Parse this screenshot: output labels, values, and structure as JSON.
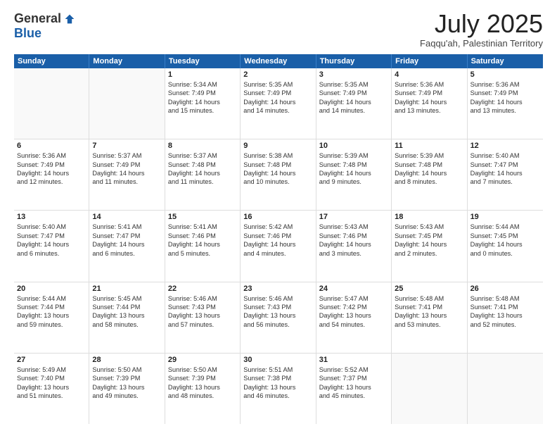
{
  "header": {
    "logo_general": "General",
    "logo_blue": "Blue",
    "title": "July 2025",
    "subtitle": "Faqqu'ah, Palestinian Territory"
  },
  "weekdays": [
    "Sunday",
    "Monday",
    "Tuesday",
    "Wednesday",
    "Thursday",
    "Friday",
    "Saturday"
  ],
  "rows": [
    [
      {
        "day": "",
        "lines": [],
        "empty": true
      },
      {
        "day": "",
        "lines": [],
        "empty": true
      },
      {
        "day": "1",
        "lines": [
          "Sunrise: 5:34 AM",
          "Sunset: 7:49 PM",
          "Daylight: 14 hours",
          "and 15 minutes."
        ]
      },
      {
        "day": "2",
        "lines": [
          "Sunrise: 5:35 AM",
          "Sunset: 7:49 PM",
          "Daylight: 14 hours",
          "and 14 minutes."
        ]
      },
      {
        "day": "3",
        "lines": [
          "Sunrise: 5:35 AM",
          "Sunset: 7:49 PM",
          "Daylight: 14 hours",
          "and 14 minutes."
        ]
      },
      {
        "day": "4",
        "lines": [
          "Sunrise: 5:36 AM",
          "Sunset: 7:49 PM",
          "Daylight: 14 hours",
          "and 13 minutes."
        ]
      },
      {
        "day": "5",
        "lines": [
          "Sunrise: 5:36 AM",
          "Sunset: 7:49 PM",
          "Daylight: 14 hours",
          "and 13 minutes."
        ]
      }
    ],
    [
      {
        "day": "6",
        "lines": [
          "Sunrise: 5:36 AM",
          "Sunset: 7:49 PM",
          "Daylight: 14 hours",
          "and 12 minutes."
        ]
      },
      {
        "day": "7",
        "lines": [
          "Sunrise: 5:37 AM",
          "Sunset: 7:49 PM",
          "Daylight: 14 hours",
          "and 11 minutes."
        ]
      },
      {
        "day": "8",
        "lines": [
          "Sunrise: 5:37 AM",
          "Sunset: 7:48 PM",
          "Daylight: 14 hours",
          "and 11 minutes."
        ]
      },
      {
        "day": "9",
        "lines": [
          "Sunrise: 5:38 AM",
          "Sunset: 7:48 PM",
          "Daylight: 14 hours",
          "and 10 minutes."
        ]
      },
      {
        "day": "10",
        "lines": [
          "Sunrise: 5:39 AM",
          "Sunset: 7:48 PM",
          "Daylight: 14 hours",
          "and 9 minutes."
        ]
      },
      {
        "day": "11",
        "lines": [
          "Sunrise: 5:39 AM",
          "Sunset: 7:48 PM",
          "Daylight: 14 hours",
          "and 8 minutes."
        ]
      },
      {
        "day": "12",
        "lines": [
          "Sunrise: 5:40 AM",
          "Sunset: 7:47 PM",
          "Daylight: 14 hours",
          "and 7 minutes."
        ]
      }
    ],
    [
      {
        "day": "13",
        "lines": [
          "Sunrise: 5:40 AM",
          "Sunset: 7:47 PM",
          "Daylight: 14 hours",
          "and 6 minutes."
        ]
      },
      {
        "day": "14",
        "lines": [
          "Sunrise: 5:41 AM",
          "Sunset: 7:47 PM",
          "Daylight: 14 hours",
          "and 6 minutes."
        ]
      },
      {
        "day": "15",
        "lines": [
          "Sunrise: 5:41 AM",
          "Sunset: 7:46 PM",
          "Daylight: 14 hours",
          "and 5 minutes."
        ]
      },
      {
        "day": "16",
        "lines": [
          "Sunrise: 5:42 AM",
          "Sunset: 7:46 PM",
          "Daylight: 14 hours",
          "and 4 minutes."
        ]
      },
      {
        "day": "17",
        "lines": [
          "Sunrise: 5:43 AM",
          "Sunset: 7:46 PM",
          "Daylight: 14 hours",
          "and 3 minutes."
        ]
      },
      {
        "day": "18",
        "lines": [
          "Sunrise: 5:43 AM",
          "Sunset: 7:45 PM",
          "Daylight: 14 hours",
          "and 2 minutes."
        ]
      },
      {
        "day": "19",
        "lines": [
          "Sunrise: 5:44 AM",
          "Sunset: 7:45 PM",
          "Daylight: 14 hours",
          "and 0 minutes."
        ]
      }
    ],
    [
      {
        "day": "20",
        "lines": [
          "Sunrise: 5:44 AM",
          "Sunset: 7:44 PM",
          "Daylight: 13 hours",
          "and 59 minutes."
        ]
      },
      {
        "day": "21",
        "lines": [
          "Sunrise: 5:45 AM",
          "Sunset: 7:44 PM",
          "Daylight: 13 hours",
          "and 58 minutes."
        ]
      },
      {
        "day": "22",
        "lines": [
          "Sunrise: 5:46 AM",
          "Sunset: 7:43 PM",
          "Daylight: 13 hours",
          "and 57 minutes."
        ]
      },
      {
        "day": "23",
        "lines": [
          "Sunrise: 5:46 AM",
          "Sunset: 7:43 PM",
          "Daylight: 13 hours",
          "and 56 minutes."
        ]
      },
      {
        "day": "24",
        "lines": [
          "Sunrise: 5:47 AM",
          "Sunset: 7:42 PM",
          "Daylight: 13 hours",
          "and 54 minutes."
        ]
      },
      {
        "day": "25",
        "lines": [
          "Sunrise: 5:48 AM",
          "Sunset: 7:41 PM",
          "Daylight: 13 hours",
          "and 53 minutes."
        ]
      },
      {
        "day": "26",
        "lines": [
          "Sunrise: 5:48 AM",
          "Sunset: 7:41 PM",
          "Daylight: 13 hours",
          "and 52 minutes."
        ]
      }
    ],
    [
      {
        "day": "27",
        "lines": [
          "Sunrise: 5:49 AM",
          "Sunset: 7:40 PM",
          "Daylight: 13 hours",
          "and 51 minutes."
        ]
      },
      {
        "day": "28",
        "lines": [
          "Sunrise: 5:50 AM",
          "Sunset: 7:39 PM",
          "Daylight: 13 hours",
          "and 49 minutes."
        ]
      },
      {
        "day": "29",
        "lines": [
          "Sunrise: 5:50 AM",
          "Sunset: 7:39 PM",
          "Daylight: 13 hours",
          "and 48 minutes."
        ]
      },
      {
        "day": "30",
        "lines": [
          "Sunrise: 5:51 AM",
          "Sunset: 7:38 PM",
          "Daylight: 13 hours",
          "and 46 minutes."
        ]
      },
      {
        "day": "31",
        "lines": [
          "Sunrise: 5:52 AM",
          "Sunset: 7:37 PM",
          "Daylight: 13 hours",
          "and 45 minutes."
        ]
      },
      {
        "day": "",
        "lines": [],
        "empty": true
      },
      {
        "day": "",
        "lines": [],
        "empty": true
      }
    ]
  ]
}
